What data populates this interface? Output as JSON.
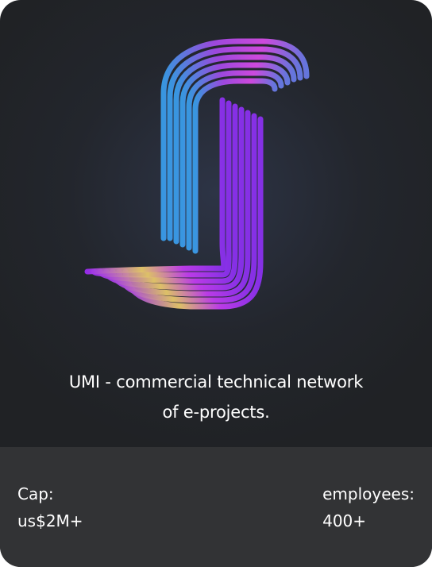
{
  "logo": {
    "icon": "umi-logo-icon",
    "colors": {
      "purple": "#c21cf0",
      "magenta": "#8e1fe6",
      "blue": "#3aa2f2",
      "yellow": "#f2d35a"
    }
  },
  "tagline": {
    "line1": "UMI - commercial technical network",
    "line2": "of e-projects."
  },
  "stats": {
    "cap": {
      "label": "Cap:",
      "value": "us$2M+"
    },
    "employees": {
      "label": "employees:",
      "value": "400+"
    }
  }
}
